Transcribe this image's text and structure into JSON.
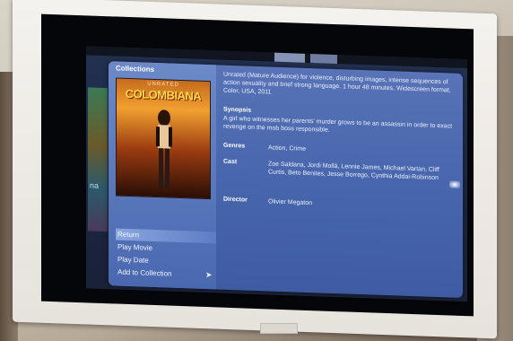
{
  "panel": {
    "title": "Collections"
  },
  "cover": {
    "badge": "UNRATED",
    "title": "COLOMBIANA"
  },
  "description": "Unrated (Mature Audience) for violence, disturbing images, intense sequences of action sexuality and brief strong language. 1 hour 48 minutes, Widescreen format, Color, USA, 2011",
  "synopsis": {
    "label": "Synopsis",
    "text": "A girl who witnesses her parents' murder grows to be an assassin in order to exact revenge on the mob boss responsible."
  },
  "genres": {
    "label": "Genres",
    "value": "Action, Crime"
  },
  "cast": {
    "label": "Cast",
    "value": "Zoe Saldana, Jordi Mollà, Lennie James, Michael Vartan, Cliff Curtis, Beto Benites, Jesse Borrego, Cynthia Addai-Robinson"
  },
  "director": {
    "label": "Director",
    "value": "Olivier Megaton"
  },
  "menu": {
    "items": [
      {
        "label": "Return"
      },
      {
        "label": "Play Movie"
      },
      {
        "label": "Play Date"
      },
      {
        "label": "Add to Collection"
      }
    ]
  },
  "side": {
    "label": "na"
  },
  "colors": {
    "panel": "#4866ad",
    "selected": "#8aa6e0",
    "text": "#e9eefb"
  }
}
